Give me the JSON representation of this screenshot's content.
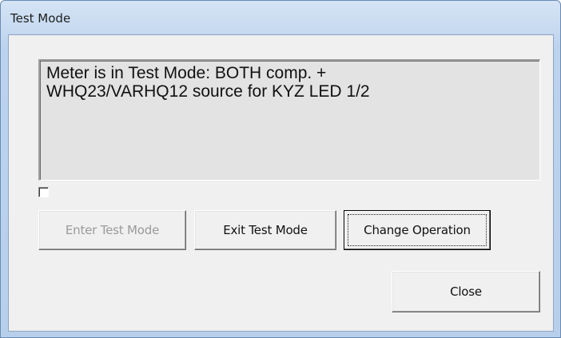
{
  "window": {
    "title": "Test Mode"
  },
  "status": {
    "text": "Meter is in Test Mode: BOTH comp. +\nWHQ23/VARHQ12 source for KYZ LED 1/2"
  },
  "checkbox": {
    "checked": false
  },
  "buttons": {
    "enter_test_mode": "Enter Test Mode",
    "exit_test_mode": "Exit Test Mode",
    "change_operation": "Change Operation",
    "close": "Close"
  }
}
